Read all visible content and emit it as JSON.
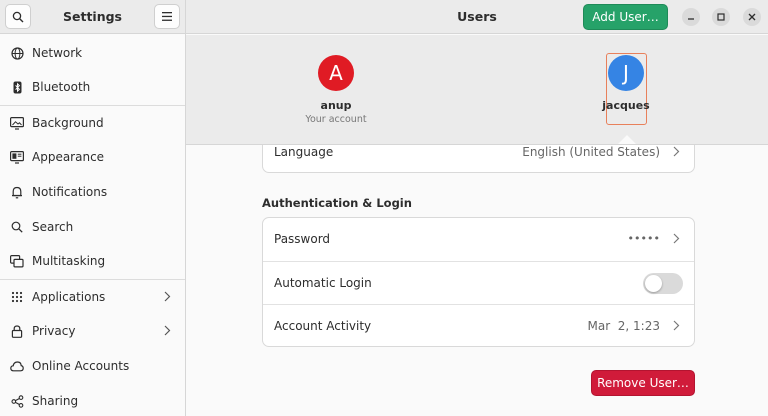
{
  "sidebar": {
    "title": "Settings",
    "search_icon": "search-icon",
    "menu_icon": "hamburger-menu-icon",
    "items": [
      {
        "label": "Network",
        "icon": "network-icon"
      },
      {
        "label": "Bluetooth",
        "icon": "bluetooth-icon"
      },
      {
        "label": "Background",
        "icon": "background-icon"
      },
      {
        "label": "Appearance",
        "icon": "appearance-icon"
      },
      {
        "label": "Notifications",
        "icon": "bell-icon"
      },
      {
        "label": "Search",
        "icon": "search-icon"
      },
      {
        "label": "Multitasking",
        "icon": "multitasking-icon"
      },
      {
        "label": "Applications",
        "icon": "grid-icon"
      },
      {
        "label": "Privacy",
        "icon": "lock-icon"
      },
      {
        "label": "Online Accounts",
        "icon": "cloud-icon"
      },
      {
        "label": "Sharing",
        "icon": "share-icon"
      }
    ]
  },
  "header": {
    "title": "Users",
    "add_user_label": "Add User…"
  },
  "users": [
    {
      "initial": "A",
      "name": "anup",
      "subtitle": "Your account",
      "color": "#e01b24"
    },
    {
      "initial": "J",
      "name": "jacques",
      "subtitle": "",
      "color": "#3584e4"
    }
  ],
  "language_row": {
    "label": "Language",
    "value": "English (United States)"
  },
  "auth": {
    "section_title": "Authentication & Login",
    "password_label": "Password",
    "password_value": "•••••",
    "auto_login_label": "Automatic Login",
    "auto_login_enabled": false,
    "activity_label": "Account Activity",
    "activity_value": "Mar  2, 1:23"
  },
  "remove_user_label": "Remove User…",
  "colors": {
    "accent_green": "#26a269",
    "danger_red": "#d01b3a",
    "selection": "#e8805b"
  }
}
